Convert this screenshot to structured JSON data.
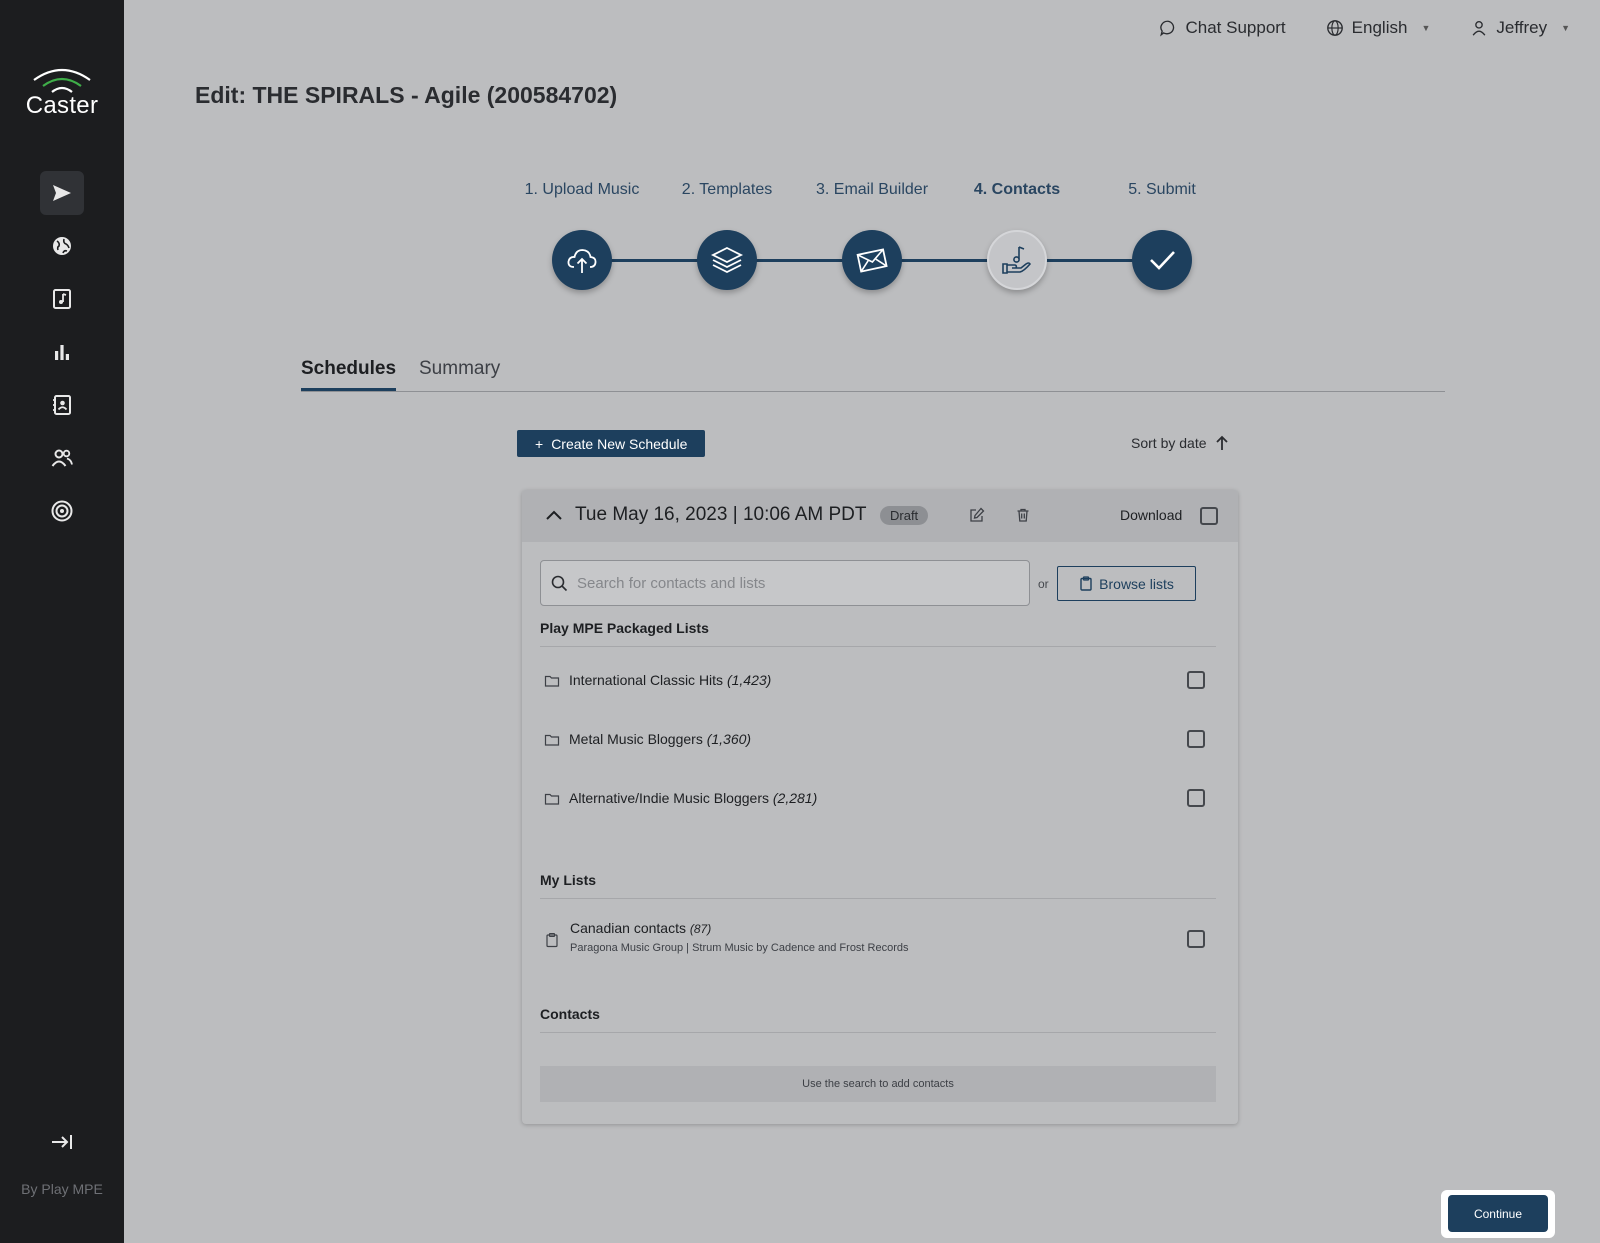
{
  "app": {
    "logo_text": "Caster",
    "footer_text": "By Play MPE"
  },
  "topbar": {
    "chat_support": "Chat Support",
    "language": "English",
    "user": "Jeffrey"
  },
  "page": {
    "title": "Edit: THE SPIRALS - Agile (200584702)"
  },
  "stepper": {
    "steps": [
      {
        "label": "1. Upload Music",
        "icon": "cloud-upload-icon",
        "state": "done"
      },
      {
        "label": "2. Templates",
        "icon": "layers-icon",
        "state": "done"
      },
      {
        "label": "3. Email Builder",
        "icon": "envelope-icon",
        "state": "done"
      },
      {
        "label": "4. Contacts",
        "icon": "hand-music-note-icon",
        "state": "current"
      },
      {
        "label": "5. Submit",
        "icon": "checkmark-icon",
        "state": "todo"
      }
    ]
  },
  "tabs": [
    {
      "label": "Schedules",
      "active": true
    },
    {
      "label": "Summary",
      "active": false
    }
  ],
  "toolbar": {
    "create_label": "Create New Schedule",
    "sort_label": "Sort by date"
  },
  "schedule": {
    "date": "Tue May 16, 2023 | 10:06 AM PDT",
    "status": "Draft",
    "download_label": "Download",
    "search_placeholder": "Search for contacts and lists",
    "or_label": "or",
    "browse_label": "Browse lists",
    "packaged_title": "Play MPE Packaged Lists",
    "packaged_lists": [
      {
        "name": "International Classic Hits",
        "count": "(1,423)"
      },
      {
        "name": "Metal Music Bloggers",
        "count": "(1,360)"
      },
      {
        "name": "Alternative/Indie Music Bloggers",
        "count": "(2,281)"
      }
    ],
    "my_lists_title": "My Lists",
    "my_lists": [
      {
        "name": "Canadian contacts",
        "count": "(87)",
        "sub": "Paragona Music Group | Strum Music by Cadence and Frost Records"
      }
    ],
    "contacts_title": "Contacts",
    "contacts_empty": "Use the search to add contacts"
  },
  "footer": {
    "continue_label": "Continue"
  },
  "colors": {
    "accent": "#1d3f5d",
    "sidebar": "#1c1d1f",
    "background": "#bcbdbf"
  }
}
